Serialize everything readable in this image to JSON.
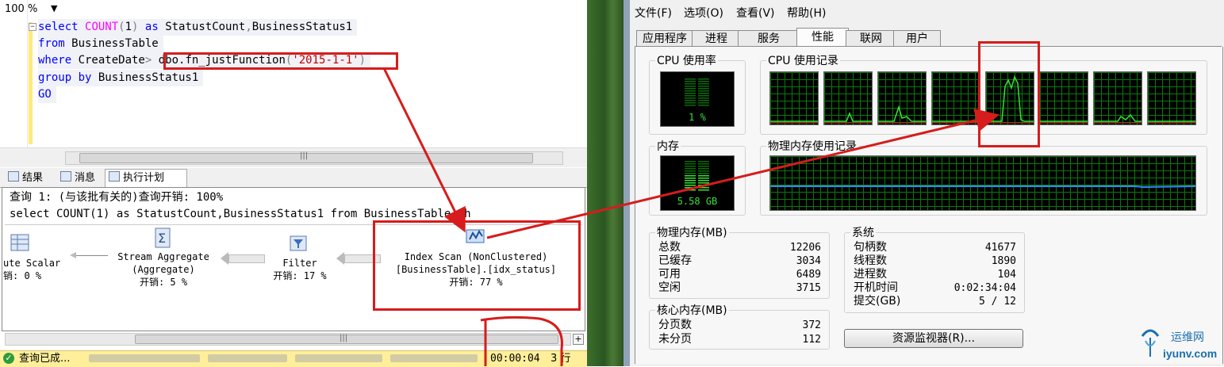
{
  "sql_editor": {
    "lines": [
      {
        "parts": [
          [
            "kw",
            "select "
          ],
          [
            "fn",
            "COUNT"
          ],
          [
            "gray",
            "("
          ],
          [
            "",
            "1"
          ],
          [
            "gray",
            ")"
          ],
          [
            "kw",
            " as "
          ],
          [
            "",
            "StatustCount"
          ],
          [
            "gray",
            ","
          ],
          [
            "",
            "BusinessStatus1"
          ]
        ]
      },
      {
        "parts": [
          [
            "kw",
            "from "
          ],
          [
            "",
            "BusinessTable"
          ]
        ]
      },
      {
        "parts": [
          [
            "kw",
            "where "
          ],
          [
            "",
            "CreateDate"
          ],
          [
            "gray",
            "> "
          ],
          [
            "",
            "dbo.fn_justFunction"
          ],
          [
            "gray",
            "("
          ],
          [
            "str",
            "'2015-1-1'"
          ],
          [
            "gray",
            ")"
          ]
        ]
      },
      {
        "parts": [
          [
            "kw",
            "group by "
          ],
          [
            "",
            "BusinessStatus1"
          ]
        ]
      },
      {
        "parts": [
          [
            "kw",
            "GO"
          ]
        ]
      }
    ]
  },
  "zoom": {
    "label": "100 %"
  },
  "result_tabs": {
    "results": "结果",
    "messages": "消息",
    "plan": "执行计划"
  },
  "plan": {
    "query_header": "查询 1: (与该批有关的)查询开销: 100%",
    "statement": "select COUNT(1) as StatustCount,BusinessStatus1 from BusinessTable wh",
    "operators": {
      "compute_scalar": {
        "line1": "ute Scalar",
        "cost": "销: 0 %"
      },
      "stream_aggregate": {
        "line1": "Stream Aggregate",
        "line2": "(Aggregate)",
        "cost": "开销: 5 %"
      },
      "filter": {
        "line1": "Filter",
        "cost": "开销: 17 %"
      },
      "index_scan": {
        "line1": "Index Scan (NonClustered)",
        "line2": "[BusinessTable].[idx_status]",
        "cost": "开销: 77 %"
      }
    }
  },
  "status_bar": {
    "text": "查询已成...",
    "elapsed": "00:00:04",
    "rows": "3 行"
  },
  "task_manager": {
    "menu": {
      "file": "文件(F)",
      "options": "选项(O)",
      "view": "查看(V)",
      "help": "帮助(H)"
    },
    "tabs": [
      "应用程序",
      "进程",
      "服务",
      "性能",
      "联网",
      "用户"
    ],
    "active_tab": "性能",
    "cpu_usage": {
      "title": "CPU 使用率",
      "value": "1 %"
    },
    "cpu_history": {
      "title": "CPU 使用记录"
    },
    "memory": {
      "title": "内存",
      "value": "5.58 GB"
    },
    "memory_history": {
      "title": "物理内存使用记录"
    },
    "physical_memory": {
      "title": "物理内存(MB)",
      "rows": [
        {
          "label": "总数",
          "value": "12206"
        },
        {
          "label": "已缓存",
          "value": "3034"
        },
        {
          "label": "可用",
          "value": "6489"
        },
        {
          "label": "空闲",
          "value": "3715"
        }
      ]
    },
    "kernel_memory": {
      "title": "核心内存(MB)",
      "rows": [
        {
          "label": "分页数",
          "value": "372"
        },
        {
          "label": "未分页",
          "value": "112"
        }
      ]
    },
    "system": {
      "title": "系统",
      "rows": [
        {
          "label": "句柄数",
          "value": "41677"
        },
        {
          "label": "线程数",
          "value": "1890"
        },
        {
          "label": "进程数",
          "value": "104"
        },
        {
          "label": "开机时间",
          "value": "0:02:34:04"
        },
        {
          "label": "提交(GB)",
          "value": "5 / 12"
        }
      ]
    },
    "resource_monitor_button": "资源监视器(R)..."
  },
  "watermark": {
    "name": "运维网",
    "domain": "iyunv.com"
  },
  "colors": {
    "annotation_red": "#d61c1c",
    "graph_green": "#37e137",
    "status_yellow": "#ffef9a"
  }
}
